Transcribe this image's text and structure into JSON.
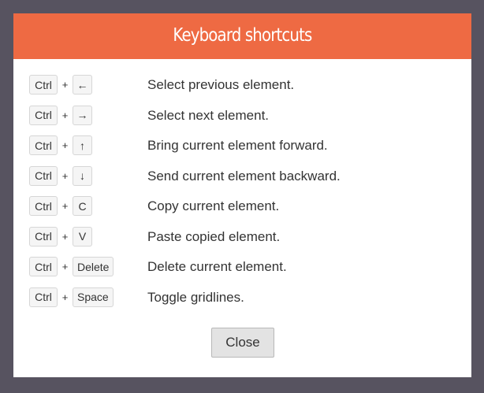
{
  "modal": {
    "title": "Keyboard shortcuts",
    "close_label": "Close"
  },
  "shortcuts": [
    {
      "modifier": "Ctrl",
      "plus": "+",
      "key": "←",
      "description": "Select previous element."
    },
    {
      "modifier": "Ctrl",
      "plus": "+",
      "key": "→",
      "description": "Select next element."
    },
    {
      "modifier": "Ctrl",
      "plus": "+",
      "key": "↑",
      "description": "Bring current element forward."
    },
    {
      "modifier": "Ctrl",
      "plus": "+",
      "key": "↓",
      "description": "Send current element backward."
    },
    {
      "modifier": "Ctrl",
      "plus": "+",
      "key": "C",
      "description": "Copy current element."
    },
    {
      "modifier": "Ctrl",
      "plus": "+",
      "key": "V",
      "description": "Paste copied element."
    },
    {
      "modifier": "Ctrl",
      "plus": "+",
      "key": "Delete",
      "description": "Delete current element."
    },
    {
      "modifier": "Ctrl",
      "plus": "+",
      "key": "Space",
      "description": "Toggle gridlines."
    }
  ],
  "colors": {
    "backdrop": "#575360",
    "header": "#ee6a43",
    "modal_bg": "#ffffff",
    "button_bg": "#e3e3e3"
  }
}
